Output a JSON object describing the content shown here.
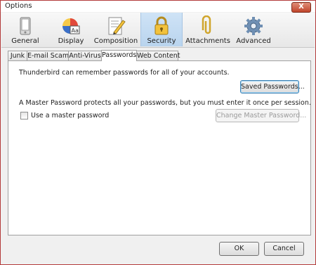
{
  "window": {
    "title": "Options",
    "close_glyph": "X"
  },
  "toolbar": {
    "items": [
      {
        "label": "General",
        "icon": "general-icon"
      },
      {
        "label": "Display",
        "icon": "display-icon"
      },
      {
        "label": "Composition",
        "icon": "composition-icon"
      },
      {
        "label": "Security",
        "icon": "lock-icon",
        "selected": true
      },
      {
        "label": "Attachments",
        "icon": "paperclip-icon"
      },
      {
        "label": "Advanced",
        "icon": "gear-icon"
      }
    ]
  },
  "tabs": [
    {
      "label": "Junk"
    },
    {
      "label": "E-mail Scams"
    },
    {
      "label": "Anti-Virus"
    },
    {
      "label": "Passwords",
      "active": true
    },
    {
      "label": "Web Content"
    }
  ],
  "passwords": {
    "remember_text": "Thunderbird can remember passwords for all of your accounts.",
    "saved_passwords_button": "Saved Passwords...",
    "master_text": "A Master Password protects all your passwords, but you must enter it once per session.",
    "use_master_checkbox_label": "Use a master password",
    "use_master_checked": false,
    "change_master_button": "Change Master Password..."
  },
  "footer": {
    "ok_label": "OK",
    "cancel_label": "Cancel"
  }
}
